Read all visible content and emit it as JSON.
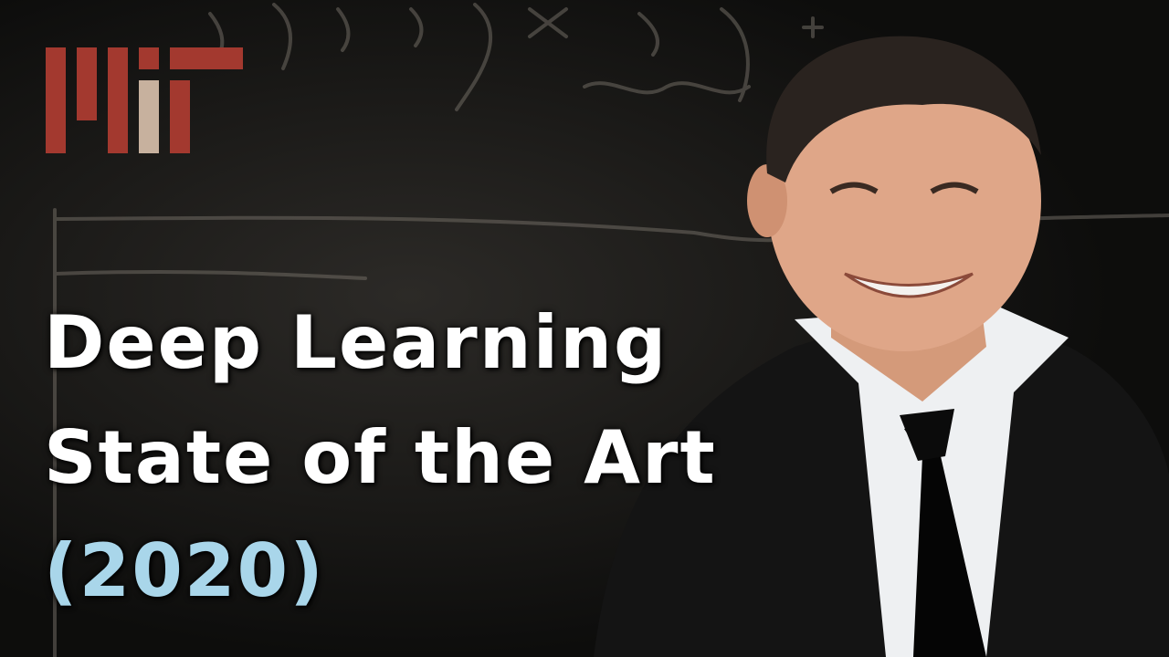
{
  "thumbnail": {
    "logo": {
      "icon": "mit-logo-icon",
      "colors": {
        "primary": "#a3392f",
        "accent": "#c7b19e"
      }
    },
    "title": {
      "line1": "Deep Learning",
      "line2": "State of the Art",
      "year": "(2020)"
    },
    "colors": {
      "title_text": "#ffffff",
      "year_text": "#a9d6ea",
      "background": "#1b1a18"
    }
  }
}
